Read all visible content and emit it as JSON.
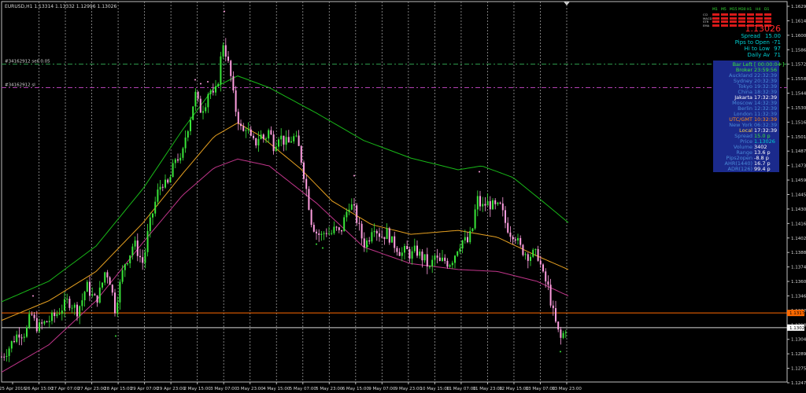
{
  "window": {
    "title": "EURUSD,H1  1.13314 1.13332 1.12996 1.13026"
  },
  "colors": {
    "background": "#000000",
    "grid": "#9a9a9a",
    "bull": "#39e639",
    "bear": "#ff9ee0",
    "ma_fast": "#e6a020",
    "ma_mid": "#18b818",
    "ma_slow": "#c0358a",
    "ask_line": "#ff6a00",
    "bid_line": "#d8d8d8",
    "axis_text": "#d8d8d8",
    "order_tp": "#2e9e4f",
    "order_sl": "#b040b0"
  },
  "orders": [
    {
      "label": "#34162912 sell 0.05",
      "price": 1.1572
    },
    {
      "label": "#34162912 sl",
      "price": 1.1548
    }
  ],
  "price_axis": {
    "ticks": [
      "1.16290",
      "1.16145",
      "1.16005",
      "1.15865",
      "1.15725",
      "1.15580",
      "1.15440",
      "1.15300",
      "1.15160",
      "1.15015",
      "1.14875",
      "1.14735",
      "1.14590",
      "1.14450",
      "1.14305",
      "1.14165",
      "1.14025",
      "1.13885",
      "1.13740",
      "1.13600",
      "1.13460",
      "1.13320",
      "1.13180",
      "1.13040",
      "1.12895",
      "1.12755",
      "1.12470"
    ],
    "ask_label": "1.13176",
    "bid_label": "1.13026"
  },
  "time_axis": {
    "ticks": [
      "25 Apr 2016",
      "26 Apr 15:00",
      "27 Apr 07:00",
      "27 Apr 23:00",
      "28 Apr 15:00",
      "29 Apr 07:00",
      "29 Apr 23:00",
      "2 May 15:00",
      "3 May 07:00",
      "3 May 23:00",
      "4 May 15:00",
      "5 May 07:00",
      "5 May 23:00",
      "6 May 15:00",
      "9 May 07:00",
      "9 May 23:00",
      "10 May 15:00",
      "11 May 07:00",
      "11 May 23:00",
      "12 May 15:00",
      "13 May 07:00",
      "13 May 23:00"
    ]
  },
  "tf_panel": {
    "labels": [
      "M1",
      "M5",
      "M15",
      "M30",
      "H1",
      "H4",
      "D1"
    ],
    "rows": [
      "CCI",
      "MACD",
      "STR",
      "EMA"
    ]
  },
  "stats": {
    "price": "1.13026",
    "spread_label": "Spread",
    "spread_value": "15.00",
    "pips_open_label": "Pips to Open",
    "pips_open_value": "-71",
    "hi_low_label": "Hi to Low",
    "hi_low_value": "97",
    "daily_av_label": "Daily Av",
    "daily_av_value": "71"
  },
  "info": [
    {
      "label": "Bar Left",
      "value": "[ 00:00:04 ]",
      "lc": "#39e639",
      "vc": "#39e639"
    },
    {
      "label": "Broker",
      "value": "23:59:56",
      "lc": "#39e639",
      "vc": "#39e639"
    },
    {
      "label": "Auckland",
      "value": "22:32:39",
      "lc": "#4a8ad8",
      "vc": "#4a8ad8"
    },
    {
      "label": "Sydney",
      "value": "20:32:39",
      "lc": "#4a8ad8",
      "vc": "#4a8ad8"
    },
    {
      "label": "Tokyo",
      "value": "19:32:39",
      "lc": "#4a8ad8",
      "vc": "#4a8ad8"
    },
    {
      "label": "China",
      "value": "18:32:39",
      "lc": "#4a8ad8",
      "vc": "#4a8ad8"
    },
    {
      "label": "Jakarta",
      "value": "17:32:39",
      "lc": "#ffffff",
      "vc": "#ffffff"
    },
    {
      "label": "Moscow",
      "value": "14:32:39",
      "lc": "#4a8ad8",
      "vc": "#4a8ad8"
    },
    {
      "label": "Berlin",
      "value": "12:32:39",
      "lc": "#4a8ad8",
      "vc": "#4a8ad8"
    },
    {
      "label": "London",
      "value": "11:32:39",
      "lc": "#4a8ad8",
      "vc": "#4a8ad8"
    },
    {
      "label": "UTC/GMT",
      "value": "10:32:39",
      "lc": "#ff8c1a",
      "vc": "#ff8c1a"
    },
    {
      "label": "New York",
      "value": "06:32:39",
      "lc": "#4a8ad8",
      "vc": "#4a8ad8"
    },
    {
      "label": "Local",
      "value": "17:32:39",
      "lc": "#ffd24a",
      "vc": "#ffffff"
    },
    {
      "label": "Spread",
      "value": "15.0 p",
      "lc": "#4a8ad8",
      "vc": "#39e639"
    },
    {
      "label": "Price",
      "value": "1.13026",
      "lc": "#4a8ad8",
      "vc": "#00ced1"
    },
    {
      "label": "Volume",
      "value": "3402",
      "lc": "#4a8ad8",
      "vc": "#ffffff"
    },
    {
      "label": "Range",
      "value": "13.6 p",
      "lc": "#4a8ad8",
      "vc": "#ffffff"
    },
    {
      "label": "Pips2open",
      "value": "-8.8 p",
      "lc": "#4a8ad8",
      "vc": "#ffffff"
    },
    {
      "label": "AHR(1440)",
      "value": "16.7 p",
      "lc": "#4a8ad8",
      "vc": "#ffffff"
    },
    {
      "label": "ADR(126)",
      "value": "99.4 p",
      "lc": "#4a8ad8",
      "vc": "#ffffff"
    }
  ],
  "chart_data": {
    "type": "candlestick",
    "title": "EURUSD,H1",
    "ylim": [
      1.1247,
      1.1636
    ],
    "x_range": [
      "25 Apr 2016",
      "13 May 23:00"
    ],
    "close_path": [
      [
        0,
        1.1273
      ],
      [
        8,
        1.128
      ],
      [
        15,
        1.129
      ],
      [
        22,
        1.1298
      ],
      [
        28,
        1.1296
      ],
      [
        33,
        1.1302
      ],
      [
        37,
        1.1318
      ],
      [
        41,
        1.131
      ],
      [
        46,
        1.1302
      ],
      [
        52,
        1.1306
      ],
      [
        60,
        1.131
      ],
      [
        68,
        1.1315
      ],
      [
        76,
        1.1322
      ],
      [
        84,
        1.133
      ],
      [
        90,
        1.1326
      ],
      [
        96,
        1.132
      ],
      [
        102,
        1.133
      ],
      [
        108,
        1.1346
      ],
      [
        114,
        1.1336
      ],
      [
        120,
        1.133
      ],
      [
        126,
        1.1342
      ],
      [
        132,
        1.1362
      ],
      [
        138,
        1.135
      ],
      [
        144,
        1.1322
      ],
      [
        150,
        1.1345
      ],
      [
        156,
        1.1368
      ],
      [
        162,
        1.1376
      ],
      [
        168,
        1.139
      ],
      [
        174,
        1.1378
      ],
      [
        180,
        1.1368
      ],
      [
        186,
        1.14
      ],
      [
        192,
        1.142
      ],
      [
        198,
        1.144
      ],
      [
        204,
        1.1452
      ],
      [
        210,
        1.1446
      ],
      [
        216,
        1.146
      ],
      [
        222,
        1.148
      ],
      [
        228,
        1.147
      ],
      [
        234,
        1.15
      ],
      [
        240,
        1.1518
      ],
      [
        246,
        1.1542
      ],
      [
        252,
        1.1525
      ],
      [
        258,
        1.153
      ],
      [
        264,
        1.1548
      ],
      [
        270,
        1.1536
      ],
      [
        276,
        1.156
      ],
      [
        281,
        1.1596
      ],
      [
        286,
        1.158
      ],
      [
        291,
        1.156
      ],
      [
        296,
        1.153
      ],
      [
        301,
        1.1515
      ],
      [
        306,
        1.15
      ],
      [
        311,
        1.151
      ],
      [
        316,
        1.1495
      ],
      [
        322,
        1.149
      ],
      [
        328,
        1.15
      ],
      [
        334,
        1.1495
      ],
      [
        340,
        1.1505
      ],
      [
        346,
        1.1488
      ],
      [
        352,
        1.15
      ],
      [
        358,
        1.1494
      ],
      [
        364,
        1.149
      ],
      [
        370,
        1.1498
      ],
      [
        376,
        1.1492
      ],
      [
        382,
        1.147
      ],
      [
        388,
        1.144
      ],
      [
        394,
        1.141
      ],
      [
        400,
        1.14
      ],
      [
        406,
        1.1396
      ],
      [
        412,
        1.1402
      ],
      [
        418,
        1.1398
      ],
      [
        424,
        1.1404
      ],
      [
        430,
        1.1398
      ],
      [
        436,
        1.1415
      ],
      [
        442,
        1.143
      ],
      [
        448,
        1.1422
      ],
      [
        454,
        1.1405
      ],
      [
        460,
        1.1388
      ],
      [
        466,
        1.1392
      ],
      [
        472,
        1.141
      ],
      [
        478,
        1.14
      ],
      [
        484,
        1.1396
      ],
      [
        490,
        1.14
      ],
      [
        496,
        1.139
      ],
      [
        502,
        1.1385
      ],
      [
        508,
        1.1378
      ],
      [
        514,
        1.1382
      ],
      [
        520,
        1.1376
      ],
      [
        526,
        1.1382
      ],
      [
        532,
        1.1376
      ],
      [
        538,
        1.1372
      ],
      [
        544,
        1.1362
      ],
      [
        550,
        1.1376
      ],
      [
        556,
        1.1368
      ],
      [
        562,
        1.1372
      ],
      [
        568,
        1.1368
      ],
      [
        574,
        1.1374
      ],
      [
        580,
        1.1386
      ],
      [
        586,
        1.1392
      ],
      [
        592,
        1.139
      ],
      [
        598,
        1.1402
      ],
      [
        604,
        1.1435
      ],
      [
        610,
        1.1425
      ],
      [
        616,
        1.143
      ],
      [
        622,
        1.1428
      ],
      [
        628,
        1.1425
      ],
      [
        634,
        1.1426
      ],
      [
        640,
        1.141
      ],
      [
        646,
        1.14
      ],
      [
        652,
        1.1398
      ],
      [
        658,
        1.1385
      ],
      [
        664,
        1.138
      ],
      [
        670,
        1.1376
      ],
      [
        676,
        1.1378
      ],
      [
        682,
        1.1376
      ],
      [
        688,
        1.1355
      ],
      [
        694,
        1.1345
      ],
      [
        700,
        1.132
      ],
      [
        706,
        1.13
      ],
      [
        711,
        1.129
      ],
      [
        716,
        1.1302
      ],
      [
        720,
        1.1303
      ]
    ],
    "ma_fast": [
      [
        0,
        1.131
      ],
      [
        60,
        1.133
      ],
      [
        120,
        1.136
      ],
      [
        180,
        1.141
      ],
      [
        230,
        1.146
      ],
      [
        270,
        1.1498
      ],
      [
        300,
        1.1512
      ],
      [
        330,
        1.1498
      ],
      [
        380,
        1.1465
      ],
      [
        420,
        1.1432
      ],
      [
        470,
        1.1408
      ],
      [
        520,
        1.1398
      ],
      [
        580,
        1.1402
      ],
      [
        630,
        1.1395
      ],
      [
        680,
        1.1376
      ],
      [
        720,
        1.1362
      ]
    ],
    "ma_mid": [
      [
        0,
        1.1329
      ],
      [
        60,
        1.135
      ],
      [
        120,
        1.1386
      ],
      [
        180,
        1.1445
      ],
      [
        230,
        1.1505
      ],
      [
        270,
        1.1548
      ],
      [
        300,
        1.156
      ],
      [
        340,
        1.1548
      ],
      [
        400,
        1.1522
      ],
      [
        460,
        1.1494
      ],
      [
        520,
        1.1476
      ],
      [
        580,
        1.1464
      ],
      [
        610,
        1.1468
      ],
      [
        650,
        1.1456
      ],
      [
        690,
        1.143
      ],
      [
        720,
        1.141
      ]
    ],
    "ma_slow": [
      [
        0,
        1.1257
      ],
      [
        60,
        1.1285
      ],
      [
        120,
        1.133
      ],
      [
        180,
        1.139
      ],
      [
        230,
        1.1438
      ],
      [
        270,
        1.1466
      ],
      [
        300,
        1.1475
      ],
      [
        340,
        1.1468
      ],
      [
        400,
        1.143
      ],
      [
        460,
        1.1385
      ],
      [
        520,
        1.1368
      ],
      [
        580,
        1.1362
      ],
      [
        630,
        1.136
      ],
      [
        680,
        1.135
      ],
      [
        720,
        1.1335
      ]
    ],
    "ask": 1.13176,
    "bid": 1.13026
  }
}
